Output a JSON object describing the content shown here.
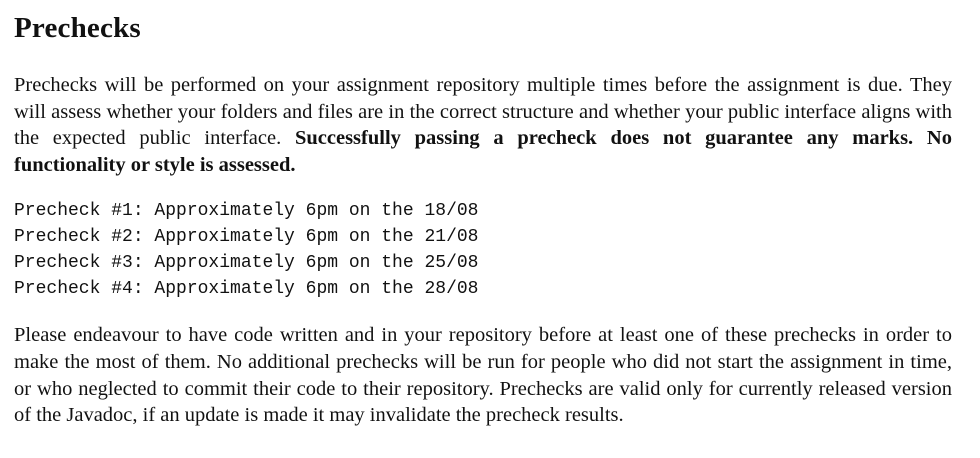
{
  "heading": "Prechecks",
  "intro": {
    "text": "Prechecks will be performed on your assignment repository multiple times before the assignment is due. They will assess whether your folders and files are in the correct structure and whether your public interface aligns with the expected public interface. ",
    "bold": "Successfully passing a precheck does not guarantee any marks. No functionality or style is assessed."
  },
  "schedule": [
    "Precheck #1: Approximately 6pm on the 18/08",
    "Precheck #2: Approximately 6pm on the 21/08",
    "Precheck #3: Approximately 6pm on the 25/08",
    "Precheck #4: Approximately 6pm on the 28/08"
  ],
  "closing": "Please endeavour to have code written and in your repository before at least one of these prechecks in order to make the most of them. No additional prechecks will be run for people who did not start the assignment in time, or who neglected to commit their code to their repository. Prechecks are valid only for currently released version of the Javadoc, if an update is made it may invalidate the precheck results."
}
